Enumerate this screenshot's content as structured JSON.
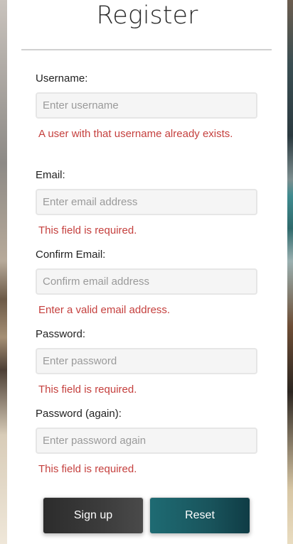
{
  "page": {
    "title": "Register"
  },
  "form": {
    "fields": [
      {
        "label": "Username:",
        "placeholder": "Enter username",
        "error": "A user with that username already exists."
      },
      {
        "label": "Email:",
        "placeholder": "Enter email address",
        "error": "This field is required."
      },
      {
        "label": "Confirm Email:",
        "placeholder": "Confirm email address",
        "error": "Enter a valid email address."
      },
      {
        "label": "Password:",
        "placeholder": "Enter password",
        "error": "This field is required."
      },
      {
        "label": "Password (again):",
        "placeholder": "Enter password again",
        "error": "This field is required."
      }
    ],
    "buttons": {
      "signup": "Sign up",
      "reset": "Reset"
    }
  },
  "colors": {
    "error": "#c5403e",
    "signup_bg": "#333333",
    "reset_bg": "#1b5e66"
  }
}
